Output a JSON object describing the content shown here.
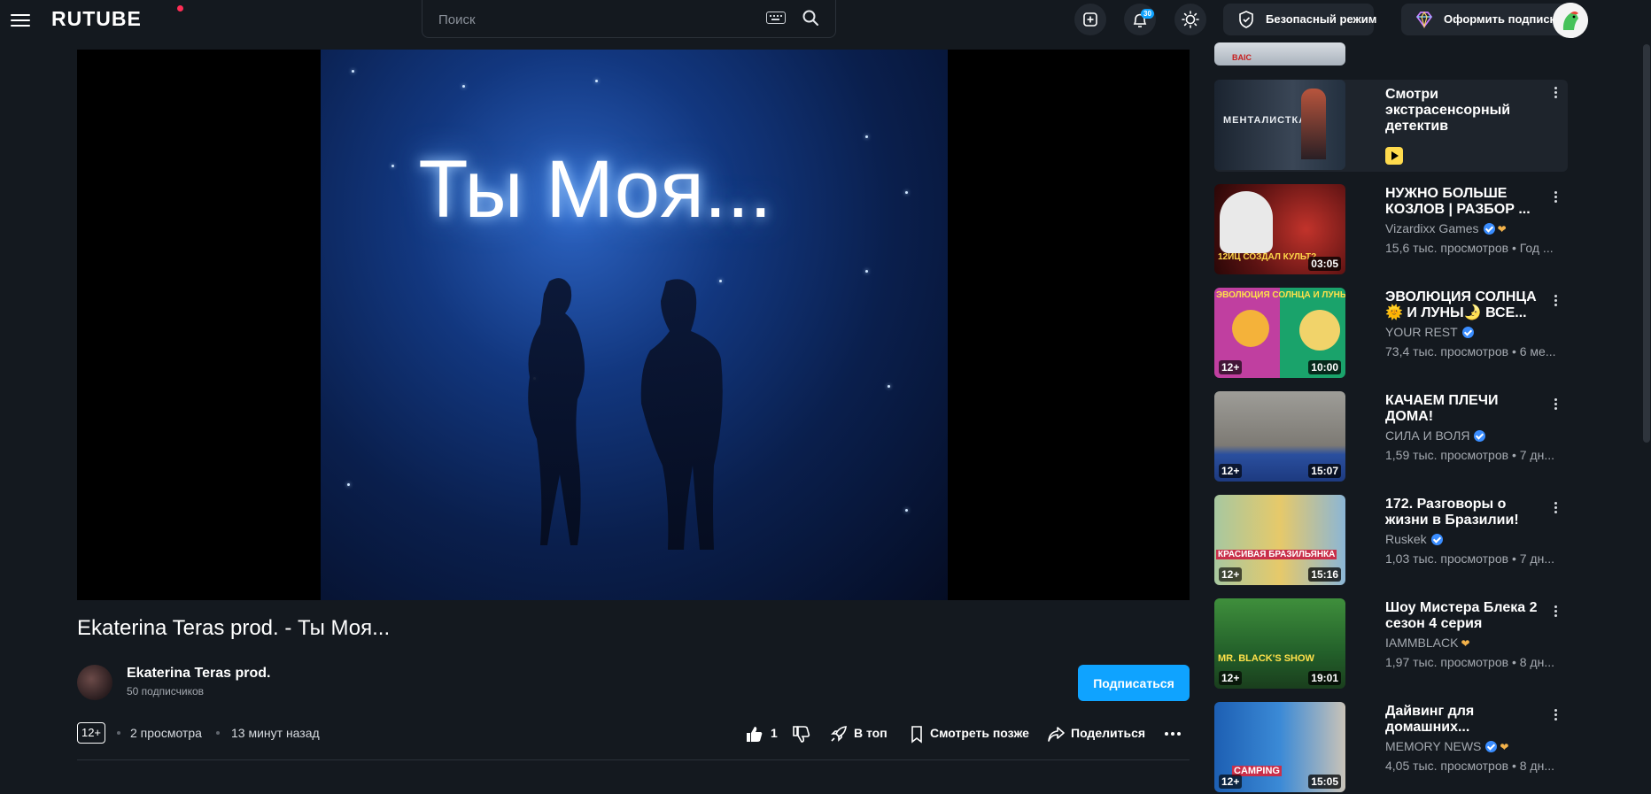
{
  "header": {
    "logo": "RUTUBE",
    "search_placeholder": "Поиск",
    "notifications_count": "30",
    "safe_mode_label": "Безопасный режим",
    "subscribe_premium_label": "Оформить подписку"
  },
  "player": {
    "overlay_text": "Ты Моя..."
  },
  "video": {
    "title": "Ekaterina Teras prod. - Ты Моя...",
    "channel_name": "Ekaterina Teras prod.",
    "channel_subscribers": "50 подписчиков",
    "subscribe_label": "Подписаться",
    "age_rating": "12+",
    "views": "2 просмотра",
    "published": "13 минут назад",
    "likes": "1",
    "to_top_label": "В топ",
    "watch_later_label": "Смотреть позже",
    "share_label": "Поделиться"
  },
  "sidebar": {
    "top_partial_thumb_text": "BAIC",
    "ad": {
      "title": "Смотри экстрасенсорный детектив",
      "thumb_text": "МЕНТАЛИСТКА"
    },
    "items": [
      {
        "title": "НУЖНО БОЛЬШЕ КОЗЛОВ | РАЗБОР ...",
        "channel": "Vizardixx Games",
        "stats": "15,6 тыс. просмотров • Год ...",
        "duration": "03:05",
        "thumb_text": "12ИЦ СОЗДАЛ КУЛЬТ?"
      },
      {
        "title": "ЭВОЛЮЦИЯ СОЛНЦА 🌞 И ЛУНЫ🌛 ВСЕ...",
        "channel": "YOUR REST",
        "stats": "73,4 тыс. просмотров • 6 ме...",
        "duration": "10:00",
        "age": "12+",
        "thumb_text": "ЭВОЛЮЦИЯ СОЛНЦА И ЛУНЫ"
      },
      {
        "title": "КАЧАЕМ ПЛЕЧИ ДОМА!",
        "channel": "СИЛА И ВОЛЯ",
        "stats": "1,59 тыс. просмотров • 7 дн...",
        "duration": "15:07",
        "age": "12+"
      },
      {
        "title": "172. Разговоры о жизни в Бразилии!",
        "channel": "Ruskek",
        "stats": "1,03 тыс. просмотров • 7 дн...",
        "duration": "15:16",
        "age": "12+",
        "thumb_text": "КРАСИВАЯ БРАЗИЛЬЯНКА"
      },
      {
        "title": "Шоу Мистера Блека 2 сезон 4 серия",
        "channel": "IAMMBLACK",
        "stats": "1,97 тыс. просмотров • 8 дн...",
        "duration": "19:01",
        "age": "12+",
        "thumb_text": "MR. BLACK'S SHOW"
      },
      {
        "title": "Дайвинг для домашних...",
        "channel": "MEMORY NEWS",
        "stats": "4,05 тыс. просмотров • 8 дн...",
        "duration": "15:05",
        "age": "12+",
        "thumb_text": "CAMPING"
      }
    ]
  }
}
